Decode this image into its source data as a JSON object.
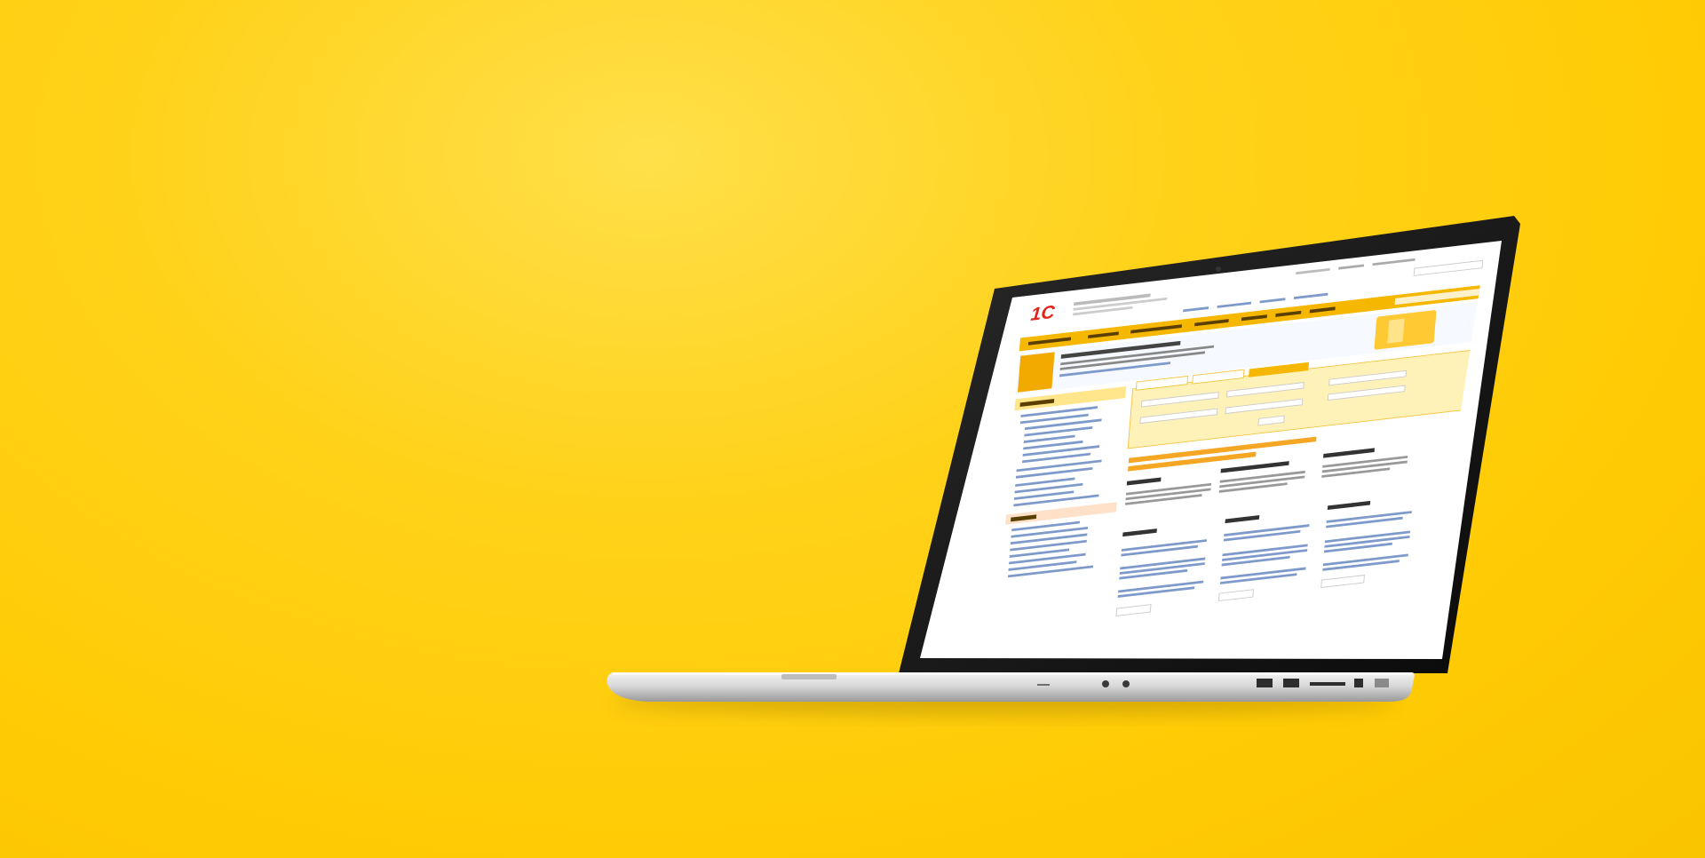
{
  "scene": {
    "description_free": true,
    "background_color": "#FFCB05",
    "device": "laptop-macbook"
  },
  "site": {
    "logo_text": "1С",
    "logo_tagline": "",
    "top_links": [
      "",
      "",
      ""
    ],
    "sub_links": [
      "",
      "",
      "",
      ""
    ],
    "nav_items": [
      "",
      "",
      "",
      "",
      "",
      "",
      ""
    ],
    "banner_title": "",
    "banner_text": "",
    "sidebar_sections": [
      {
        "title": "",
        "items": [
          "",
          "",
          "",
          "",
          "",
          "",
          "",
          "",
          "",
          "",
          "",
          "",
          "",
          "",
          ""
        ]
      },
      {
        "title": "",
        "items": [
          "",
          "",
          "",
          "",
          "",
          "",
          "",
          "",
          "",
          ""
        ]
      }
    ],
    "finder_tabs": [
      "",
      "",
      ""
    ],
    "advantages_title": "",
    "advantages_cols": [
      "",
      "",
      ""
    ],
    "news_columns": [
      {
        "title": "",
        "items": [
          "",
          "",
          ""
        ],
        "more": ""
      },
      {
        "title": "",
        "items": [
          "",
          "",
          ""
        ],
        "more": ""
      },
      {
        "title": "",
        "items": [
          "",
          "",
          ""
        ],
        "more": ""
      }
    ]
  }
}
